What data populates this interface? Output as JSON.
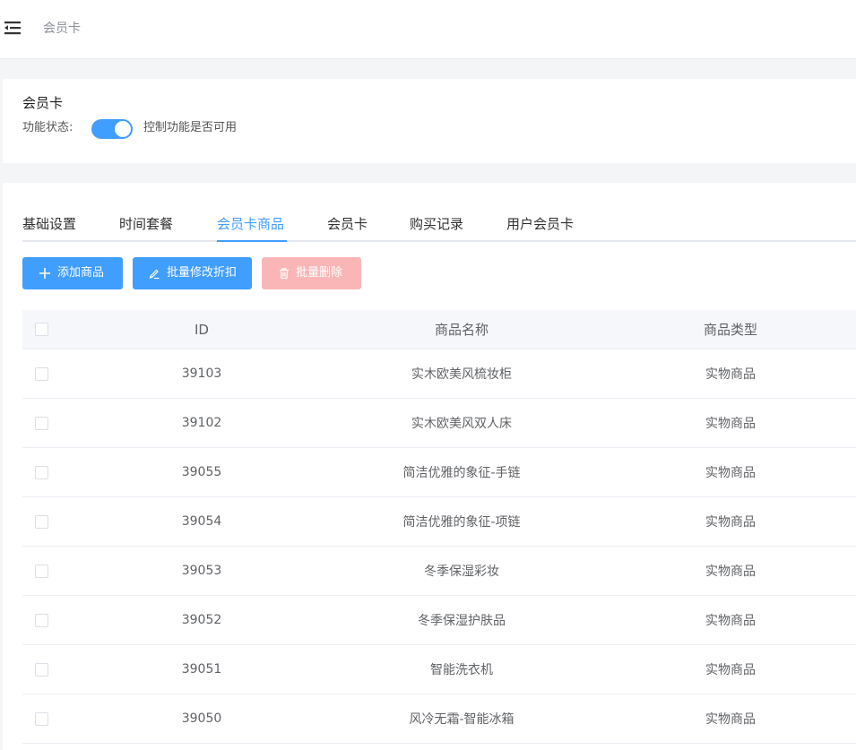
{
  "header": {
    "breadcrumb": "会员卡",
    "menu_icon": "menu-fold-icon"
  },
  "feature": {
    "title": "会员卡",
    "status_label": "功能状态:",
    "enabled": true,
    "hint": "控制功能是否可用"
  },
  "tabs": [
    {
      "label": "基础设置"
    },
    {
      "label": "时间套餐"
    },
    {
      "label": "会员卡商品",
      "active": true
    },
    {
      "label": "会员卡"
    },
    {
      "label": "购买记录"
    },
    {
      "label": "用户会员卡"
    }
  ],
  "toolbar": {
    "add_label": "添加商品",
    "edit_discount_label": "批量修改折扣",
    "delete_label": "批量删除"
  },
  "table": {
    "columns": [
      "ID",
      "商品名称",
      "商品类型"
    ],
    "rows": [
      {
        "id": "39103",
        "name": "实木欧美风梳妆柜",
        "type": "实物商品"
      },
      {
        "id": "39102",
        "name": "实木欧美风双人床",
        "type": "实物商品"
      },
      {
        "id": "39055",
        "name": "简洁优雅的象征-手链",
        "type": "实物商品"
      },
      {
        "id": "39054",
        "name": "简洁优雅的象征-项链",
        "type": "实物商品"
      },
      {
        "id": "39053",
        "name": "冬季保湿彩妆",
        "type": "实物商品"
      },
      {
        "id": "39052",
        "name": "冬季保湿护肤品",
        "type": "实物商品"
      },
      {
        "id": "39051",
        "name": "智能洗衣机",
        "type": "实物商品"
      },
      {
        "id": "39050",
        "name": "风冷无霜-智能冰箱",
        "type": "实物商品"
      }
    ]
  },
  "colors": {
    "primary": "#409eff",
    "danger_disabled": "#fab6b6"
  }
}
